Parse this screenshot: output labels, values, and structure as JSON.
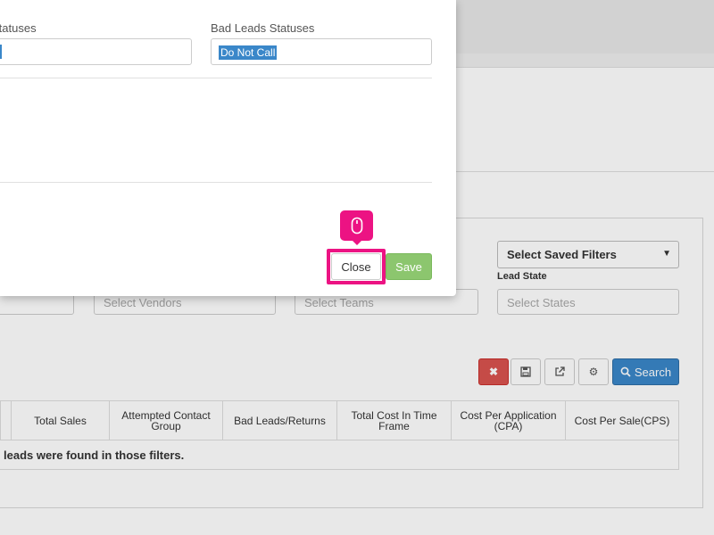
{
  "modal": {
    "left_label": "Statuses",
    "right_label": "Bad Leads Statuses",
    "right_selected": "Do Not Call",
    "close_label": "Close",
    "save_label": "Save"
  },
  "background": {
    "saved_filters_select": "Select Saved Filters",
    "lead_state_label": "Lead State",
    "inputs": {
      "vendors_placeholder": "Select Vendors",
      "teams_placeholder": "Select Teams",
      "states_placeholder": "Select States"
    },
    "search_label": "Search",
    "table": {
      "headers": [
        "Total Sales",
        "Attempted Contact Group",
        "Bad Leads/Returns",
        "Total Cost In Time Frame",
        "Cost Per Application (CPA)",
        "Cost Per Sale(CPS)"
      ],
      "empty_message": "leads were found in those filters."
    }
  },
  "colors": {
    "highlight": "#ec1383",
    "save_button": "#8cc66e",
    "search_button": "#3a87c9",
    "clear_button": "#d9534f"
  },
  "icons": {
    "click_marker": "mouse-icon",
    "clear": "close-icon",
    "save_filter": "floppy-disk-icon",
    "export": "external-link-icon",
    "settings": "gear-icon",
    "search": "search-icon"
  }
}
